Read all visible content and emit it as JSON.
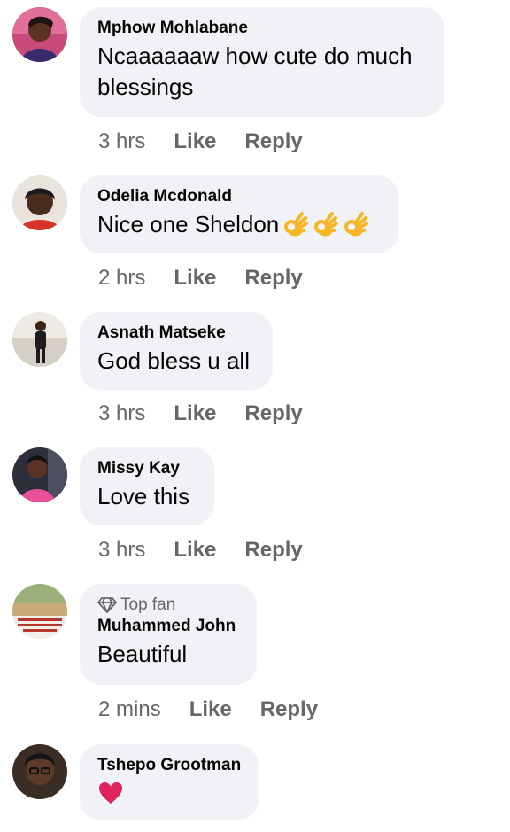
{
  "comments": [
    {
      "name": "Mphow Mohlabane",
      "text": "Ncaaaaaaw how cute do much blessings",
      "time": "3 hrs",
      "like_label": "Like",
      "reply_label": "Reply"
    },
    {
      "name": "Odelia Mcdonald",
      "text": "Nice one Sheldon",
      "reactions": [
        "ok-hand-emoji",
        "ok-hand-emoji",
        "ok-hand-emoji"
      ],
      "time": "2 hrs",
      "like_label": "Like",
      "reply_label": "Reply"
    },
    {
      "name": "Asnath Matseke",
      "text": "God bless u all",
      "time": "3 hrs",
      "like_label": "Like",
      "reply_label": "Reply"
    },
    {
      "name": "Missy Kay",
      "text": "Love this",
      "time": "3 hrs",
      "like_label": "Like",
      "reply_label": "Reply"
    },
    {
      "badge": "Top fan",
      "badge_icon": "diamond-icon",
      "name": "Muhammed John",
      "text": "Beautiful",
      "time": "2 mins",
      "like_label": "Like",
      "reply_label": "Reply"
    },
    {
      "name": "Tshepo Grootman",
      "emoji": "red-heart-emoji"
    }
  ],
  "colors": {
    "bubble": "#f0f2f5",
    "meta_text": "#65676b",
    "body_text": "#050505",
    "heart": "#e0245e",
    "ok_hand": "#f6b625"
  }
}
